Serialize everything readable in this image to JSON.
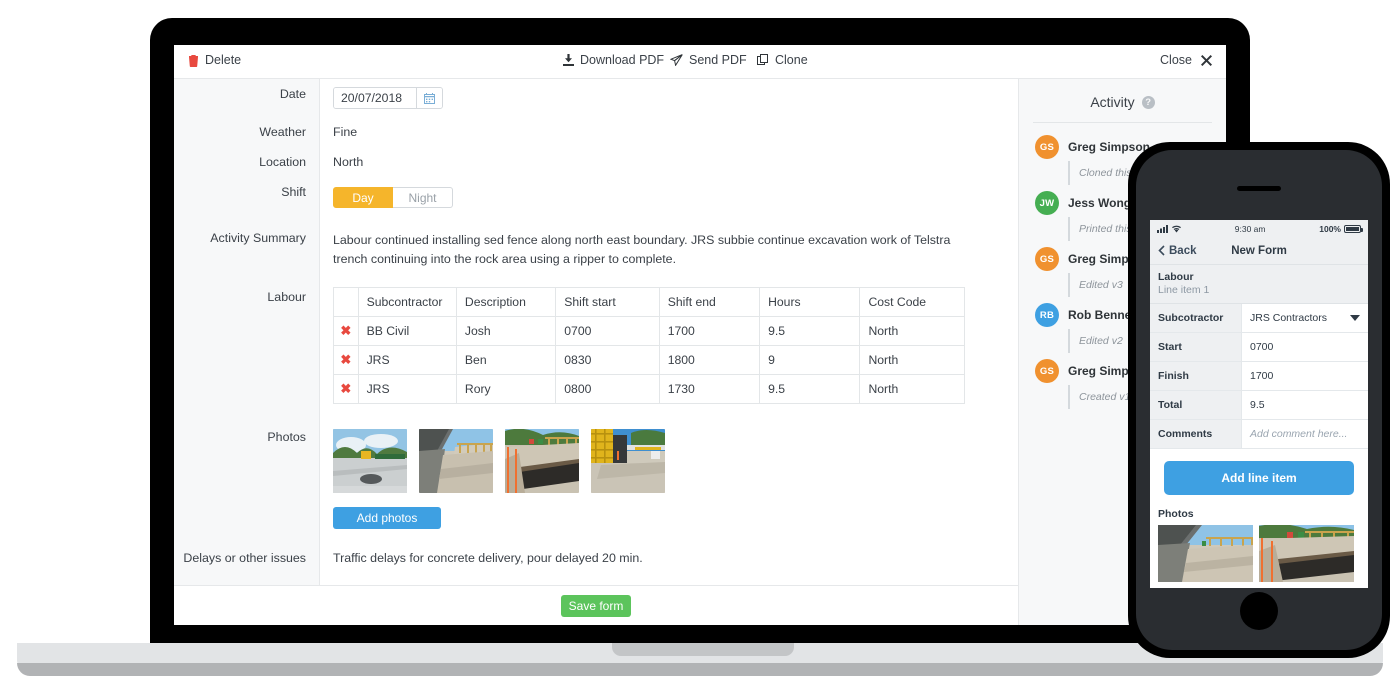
{
  "toolbar": {
    "delete": "Delete",
    "download_pdf": "Download PDF",
    "send_pdf": "Send PDF",
    "clone": "Clone",
    "close": "Close"
  },
  "form": {
    "rows": {
      "date_label": "Date",
      "date_value": "20/07/2018",
      "weather_label": "Weather",
      "weather_value": "Fine",
      "location_label": "Location",
      "location_value": "North",
      "shift_label": "Shift",
      "shift_day": "Day",
      "shift_night": "Night",
      "summary_label": "Activity Summary",
      "summary_value": "Labour continued installing sed fence along north east boundary.  JRS subbie continue excavation work of Telstra trench continuing into the rock area using a ripper to complete.",
      "labour_label": "Labour",
      "photos_label": "Photos",
      "delays_label": "Delays or other issues",
      "delays_value": "Traffic delays for concrete delivery, pour delayed 20 min."
    },
    "labour_table": {
      "headers": [
        "",
        "Subcontractor",
        "Description",
        "Shift start",
        "Shift end",
        "Hours",
        "Cost Code"
      ],
      "rows": [
        {
          "subcontractor": "BB Civil",
          "description": "Josh",
          "start": "0700",
          "end": "1700",
          "hours": "9.5",
          "cost_code": "North"
        },
        {
          "subcontractor": "JRS",
          "description": "Ben",
          "start": "0830",
          "end": "1800",
          "hours": "9",
          "cost_code": "North"
        },
        {
          "subcontractor": "JRS",
          "description": "Rory",
          "start": "0800",
          "end": "1730",
          "hours": "9.5",
          "cost_code": "North"
        }
      ]
    },
    "add_photos": "Add photos",
    "save_form": "Save form"
  },
  "activity": {
    "title": "Activity",
    "items": [
      {
        "name": "Greg Simpson",
        "initials": "GS",
        "action": "Cloned this",
        "color": "#f0912f"
      },
      {
        "name": "Jess Wong",
        "initials": "JW",
        "action": "Printed this",
        "color": "#45ae52"
      },
      {
        "name": "Greg Simpson",
        "initials": "GS",
        "action": "Edited v3",
        "color": "#f0912f"
      },
      {
        "name": "Rob Bennetts",
        "initials": "RB",
        "action": "Edited v2",
        "color": "#3ea0e2"
      },
      {
        "name": "Greg Simpson",
        "initials": "GS",
        "action": "Created v1",
        "color": "#f0912f"
      }
    ]
  },
  "phone": {
    "status": {
      "time": "9:30 am",
      "battery": "100%"
    },
    "nav": {
      "back": "Back",
      "title": "New Form"
    },
    "section": {
      "title": "Labour",
      "subtitle": "Line item 1"
    },
    "fields": [
      {
        "label": "Subcotractor",
        "value": "JRS Contractors",
        "type": "select"
      },
      {
        "label": "Start",
        "value": "0700",
        "type": "text"
      },
      {
        "label": "Finish",
        "value": "1700",
        "type": "text"
      },
      {
        "label": "Total",
        "value": "9.5",
        "type": "text"
      },
      {
        "label": "Comments",
        "value": "Add comment here...",
        "type": "placeholder"
      }
    ],
    "add_line_item": "Add line item",
    "photos_label": "Photos"
  },
  "colors": {
    "accent_blue": "#3ea0e2",
    "save_green": "#5cc45c",
    "shift_amber": "#f5b52b",
    "delete_red": "#e8493f"
  }
}
